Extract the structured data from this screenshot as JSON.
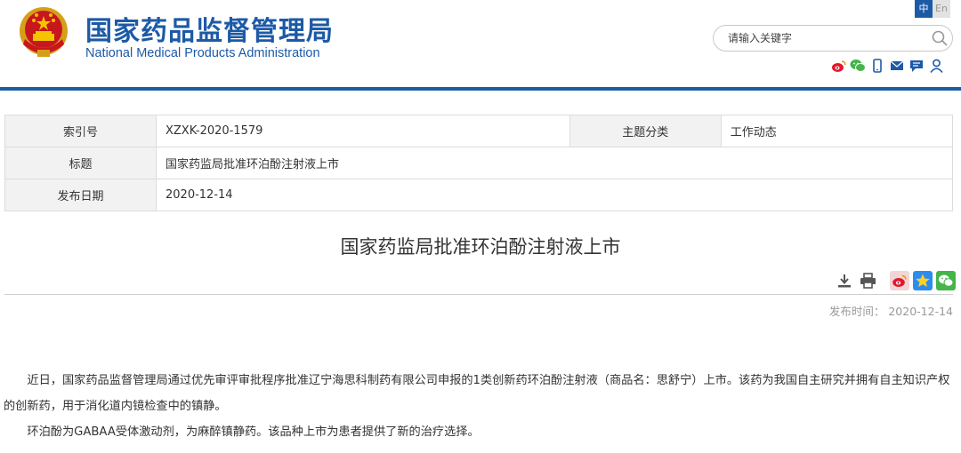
{
  "header": {
    "title_cn": "国家药品监督管理局",
    "title_en": "National Medical Products Administration",
    "lang": {
      "cn": "中",
      "en": "En"
    },
    "search": {
      "placeholder": "请输入关键字"
    },
    "social_icons": [
      "weibo-icon",
      "wechat-icon",
      "mobile-icon",
      "mail-icon",
      "message-icon",
      "user-icon"
    ],
    "colors": {
      "brand": "#1d5aa6"
    }
  },
  "info": {
    "index_label": "索引号",
    "index_value": "XZXK-2020-1579",
    "category_label": "主题分类",
    "category_value": "工作动态",
    "title_label": "标题",
    "title_value": "国家药监局批准环泊酚注射液上市",
    "date_label": "发布日期",
    "date_value": "2020-12-14"
  },
  "article": {
    "title": "国家药监局批准环泊酚注射液上市",
    "publish_label": "发布时间：",
    "publish_date": "2020-12-14",
    "tools": [
      "download-icon",
      "print-icon"
    ],
    "share": [
      {
        "name": "weibo-share-icon",
        "color": "#e6162d"
      },
      {
        "name": "qzone-share-icon",
        "color": "#2d8cf0"
      },
      {
        "name": "wechat-share-icon",
        "color": "#44b549"
      }
    ],
    "paragraphs": [
      "近日，国家药品监督管理局通过优先审评审批程序批准辽宁海思科制药有限公司申报的1类创新药环泊酚注射液（商品名：思舒宁）上市。该药为我国自主研究并拥有自主知识产权的创新药，用于消化道内镜检查中的镇静。",
      "环泊酚为GABAA受体激动剂，为麻醉镇静药。该品种上市为患者提供了新的治疗选择。"
    ]
  }
}
